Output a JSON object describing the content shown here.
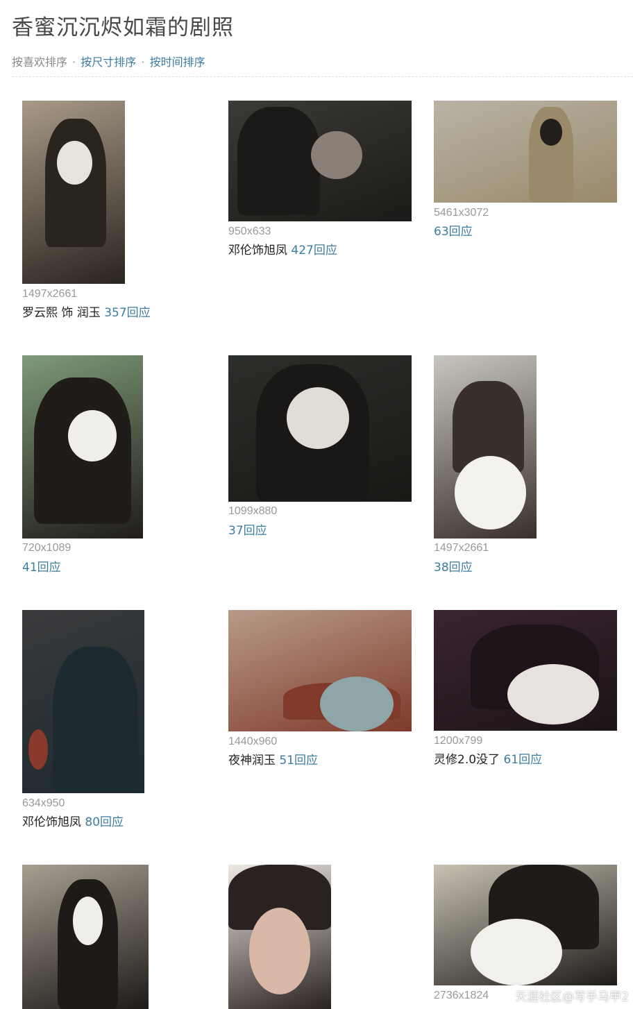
{
  "page": {
    "title": "香蜜沉沉烬如霜的剧照",
    "sort": {
      "by_likes": "按喜欢排序",
      "by_size": "按尺寸排序",
      "by_time": "按时间排序",
      "separator": "·"
    }
  },
  "photos": [
    {
      "size": "1497x2661",
      "caption": "罗云熙 饰 润玉 ",
      "replies": "357回应",
      "colors": [
        "#a89a86",
        "#2a241f",
        "#e6e2dc"
      ]
    },
    {
      "size": "950x633",
      "caption": "邓伦饰旭凤 ",
      "replies": "427回应",
      "colors": [
        "#3c3a36",
        "#1c1a18",
        "#8a8078"
      ]
    },
    {
      "size": "5461x3072",
      "caption": "",
      "replies": "63回应",
      "colors": [
        "#b9b3a6",
        "#9a8a6a",
        "#221e1b"
      ]
    },
    {
      "size": "720x1089",
      "caption": "",
      "replies": "41回应",
      "colors": [
        "#7e9a78",
        "#201c1a",
        "#f1efea"
      ]
    },
    {
      "size": "1099x880",
      "caption": "",
      "replies": "37回应",
      "colors": [
        "#2b2e2a",
        "#1a1816",
        "#e2dcd6"
      ]
    },
    {
      "size": "1497x2661",
      "caption": "",
      "replies": "38回应",
      "colors": [
        "#c8c6c0",
        "#3a302a",
        "#f3f2ef"
      ]
    },
    {
      "size": "634x950",
      "caption": "邓伦饰旭凤 ",
      "replies": "80回应",
      "colors": [
        "#3a3a3c",
        "#1d2a30",
        "#8a3a2a"
      ]
    },
    {
      "size": "1440x960",
      "caption": "夜神润玉 ",
      "replies": "51回应",
      "colors": [
        "#b89a88",
        "#7f3a2a",
        "#8fa6a8"
      ]
    },
    {
      "size": "1200x799",
      "caption": "灵修2.0没了 ",
      "replies": "61回应",
      "colors": [
        "#3a2430",
        "#1c1418",
        "#e8e2de"
      ]
    },
    {
      "size": "",
      "caption": "",
      "replies": "",
      "colors": [
        "#a89f92",
        "#1e1a18",
        "#f0eeea"
      ]
    },
    {
      "size": "",
      "caption": "",
      "replies": "",
      "colors": [
        "#efe9e4",
        "#2a2220",
        "#d9b8a8"
      ]
    },
    {
      "size": "2736x1824",
      "caption": "",
      "replies": "",
      "colors": [
        "#c8c2b4",
        "#1f1b18",
        "#f2f0ec"
      ]
    }
  ],
  "watermark": "天涯社区@写手马甲2"
}
